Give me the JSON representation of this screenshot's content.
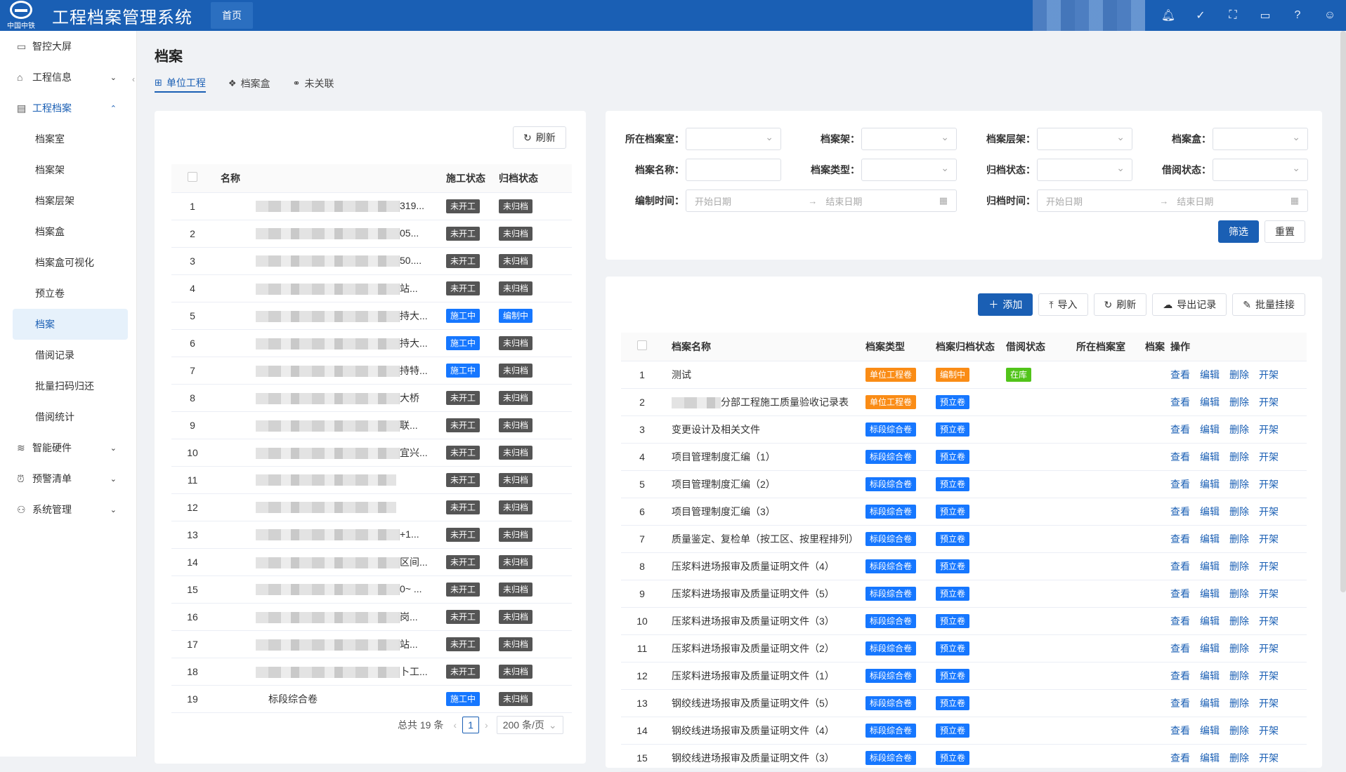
{
  "app": {
    "title": "工程档案管理系统",
    "logo_text": "中国中铁",
    "nav_home": "首页"
  },
  "sidebar": {
    "items": [
      {
        "label": "智控大屏",
        "icon": "monitor-icon"
      },
      {
        "label": "工程信息",
        "icon": "bank-icon",
        "arrow": "⌄"
      },
      {
        "label": "工程档案",
        "icon": "file-icon",
        "arrow": "⌃"
      },
      {
        "label": "智能硬件",
        "icon": "wifi-icon",
        "arrow": "⌄"
      },
      {
        "label": "预警清单",
        "icon": "alarm-icon",
        "arrow": "⌄"
      },
      {
        "label": "系统管理",
        "icon": "org-icon",
        "arrow": "⌄"
      }
    ],
    "sub": [
      "档案室",
      "档案架",
      "档案层架",
      "档案盒",
      "档案盒可视化",
      "预立卷",
      "档案",
      "借阅记录",
      "批量扫码归还",
      "借阅统计"
    ]
  },
  "page": {
    "title": "档案",
    "tabs": [
      "单位工程",
      "档案盒",
      "未关联"
    ]
  },
  "left": {
    "refresh": "刷新",
    "headers": [
      "名称",
      "施工状态",
      "归档状态"
    ],
    "rows": [
      {
        "n": "1",
        "suffix": "319...",
        "s": "未开工",
        "a": "未归档"
      },
      {
        "n": "2",
        "suffix": "05...",
        "s": "未开工",
        "a": "未归档"
      },
      {
        "n": "3",
        "suffix": "50....",
        "s": "未开工",
        "a": "未归档"
      },
      {
        "n": "4",
        "suffix": "站...",
        "s": "未开工",
        "a": "未归档"
      },
      {
        "n": "5",
        "suffix": "持大...",
        "s": "施工中",
        "a": "编制中"
      },
      {
        "n": "6",
        "suffix": "持大...",
        "s": "施工中",
        "a": "未归档"
      },
      {
        "n": "7",
        "suffix": "持特...",
        "s": "施工中",
        "a": "未归档"
      },
      {
        "n": "8",
        "suffix": "大桥",
        "s": "未开工",
        "a": "未归档"
      },
      {
        "n": "9",
        "suffix": "联...",
        "s": "未开工",
        "a": "未归档"
      },
      {
        "n": "10",
        "suffix": "宜兴...",
        "s": "未开工",
        "a": "未归档"
      },
      {
        "n": "11",
        "suffix": "",
        "s": "未开工",
        "a": "未归档"
      },
      {
        "n": "12",
        "suffix": "",
        "s": "未开工",
        "a": "未归档"
      },
      {
        "n": "13",
        "suffix": "+1...",
        "s": "未开工",
        "a": "未归档"
      },
      {
        "n": "14",
        "suffix": "区间...",
        "s": "未开工",
        "a": "未归档"
      },
      {
        "n": "15",
        "suffix": "0~ ...",
        "s": "未开工",
        "a": "未归档"
      },
      {
        "n": "16",
        "suffix": "岗...",
        "s": "未开工",
        "a": "未归档"
      },
      {
        "n": "17",
        "suffix": "站...",
        "s": "未开工",
        "a": "未归档"
      },
      {
        "n": "18",
        "suffix": "卜工...",
        "s": "未开工",
        "a": "未归档"
      },
      {
        "n": "19",
        "suffix": "",
        "name": "标段综合卷",
        "s": "施工中",
        "a": "未归档"
      }
    ],
    "pager": {
      "total": "总共 19 条",
      "page": "1",
      "size": "200 条/页"
    }
  },
  "filter": {
    "labels": [
      "所在档案室：",
      "档案架：",
      "档案层架：",
      "档案盒：",
      "档案名称：",
      "档案类型：",
      "归档状态：",
      "借阅状态：",
      "编制时间：",
      "归档时间："
    ],
    "start_ph": "开始日期",
    "end_ph": "结束日期",
    "btn_filter": "筛选",
    "btn_reset": "重置"
  },
  "right": {
    "toolbar": [
      "添加",
      "导入",
      "刷新",
      "导出记录",
      "批量挂接"
    ],
    "headers": [
      "档案名称",
      "档案类型",
      "档案归档状态",
      "借阅状态",
      "所在档案室",
      "档案",
      "操作"
    ],
    "ops": [
      "查看",
      "编辑",
      "删除",
      "开架"
    ],
    "rows": [
      {
        "n": "1",
        "name": "测试",
        "type": "单位工程卷",
        "status": "编制中",
        "borrow": "在库"
      },
      {
        "n": "2",
        "name": "分部工程施工质量验收记录表",
        "type": "单位工程卷",
        "status": "预立卷",
        "borrow": "",
        "blur": true
      },
      {
        "n": "3",
        "name": "变更设计及相关文件",
        "type": "标段综合卷",
        "status": "预立卷",
        "borrow": ""
      },
      {
        "n": "4",
        "name": "项目管理制度汇编（1）",
        "type": "标段综合卷",
        "status": "预立卷",
        "borrow": ""
      },
      {
        "n": "5",
        "name": "项目管理制度汇编（2）",
        "type": "标段综合卷",
        "status": "预立卷",
        "borrow": ""
      },
      {
        "n": "6",
        "name": "项目管理制度汇编（3）",
        "type": "标段综合卷",
        "status": "预立卷",
        "borrow": ""
      },
      {
        "n": "7",
        "name": "质量鉴定、复检单（按工区、按里程排列）",
        "type": "标段综合卷",
        "status": "预立卷",
        "borrow": ""
      },
      {
        "n": "8",
        "name": "压浆料进场报审及质量证明文件（4）",
        "type": "标段综合卷",
        "status": "预立卷",
        "borrow": ""
      },
      {
        "n": "9",
        "name": "压浆料进场报审及质量证明文件（5）",
        "type": "标段综合卷",
        "status": "预立卷",
        "borrow": ""
      },
      {
        "n": "10",
        "name": "压浆料进场报审及质量证明文件（3）",
        "type": "标段综合卷",
        "status": "预立卷",
        "borrow": ""
      },
      {
        "n": "11",
        "name": "压浆料进场报审及质量证明文件（2）",
        "type": "标段综合卷",
        "status": "预立卷",
        "borrow": ""
      },
      {
        "n": "12",
        "name": "压浆料进场报审及质量证明文件（1）",
        "type": "标段综合卷",
        "status": "预立卷",
        "borrow": ""
      },
      {
        "n": "13",
        "name": "钢绞线进场报审及质量证明文件（5）",
        "type": "标段综合卷",
        "status": "预立卷",
        "borrow": ""
      },
      {
        "n": "14",
        "name": "钢绞线进场报审及质量证明文件（4）",
        "type": "标段综合卷",
        "status": "预立卷",
        "borrow": ""
      },
      {
        "n": "15",
        "name": "钢绞线进场报审及质量证明文件（3）",
        "type": "标段综合卷",
        "status": "预立卷",
        "borrow": ""
      }
    ]
  },
  "colors": {
    "primary": "#1a5fb4",
    "tag_gray": "#555555",
    "tag_blue": "#1677ff",
    "tag_orange": "#fa8c16",
    "tag_green": "#52c41a"
  }
}
